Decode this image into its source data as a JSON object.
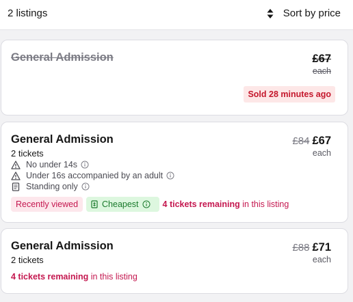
{
  "header": {
    "listings_count": "2 listings",
    "sort_label": "Sort by price",
    "sort_icon": "sort-arrows-icon"
  },
  "listings": [
    {
      "title": "General Admission",
      "price": "£67",
      "each": "each",
      "status": "Sold 28 minutes ago",
      "sold": true
    },
    {
      "title": "General Admission",
      "tickets": "2 tickets",
      "original_price": "£84",
      "price": "£67",
      "each": "each",
      "features": [
        {
          "icon": "warning-icon",
          "label": "No under 14s"
        },
        {
          "icon": "warning-icon",
          "label": "Under 16s accompanied by an adult"
        },
        {
          "icon": "document-icon",
          "label": "Standing only"
        }
      ],
      "badges": {
        "recently_viewed": "Recently viewed",
        "cheapest": "Cheapest"
      },
      "remaining_bold": "4 tickets remaining",
      "remaining_rest": " in this listing"
    },
    {
      "title": "General Admission",
      "tickets": "2 tickets",
      "original_price": "£88",
      "price": "£71",
      "each": "each",
      "remaining_bold": "4 tickets remaining",
      "remaining_rest": " in this listing"
    }
  ],
  "colors": {
    "sold_badge_bg": "#fde7e7",
    "sold_badge_text": "#c4172c",
    "accent_pink": "#c4174f",
    "cheapest_bg": "#ddf7df",
    "cheapest_text": "#1a7a2c"
  }
}
